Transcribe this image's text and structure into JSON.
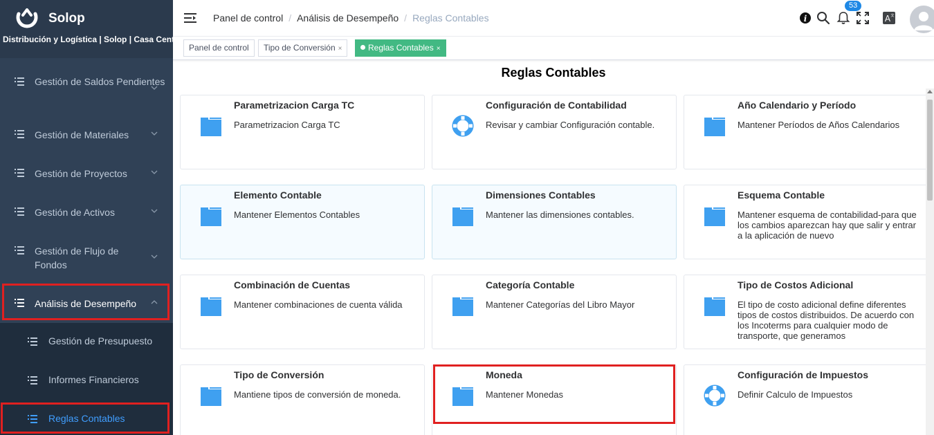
{
  "brand": {
    "name": "Solop",
    "subtitle": "Distribución y Logística | Solop | Casa Central"
  },
  "sidebar": {
    "items": [
      {
        "label": "Gestión de Saldos Pendientes",
        "expanded": false
      },
      {
        "label": "Gestión de Materiales",
        "expanded": false
      },
      {
        "label": "Gestión de Proyectos",
        "expanded": false
      },
      {
        "label": "Gestión de Activos",
        "expanded": false
      },
      {
        "label": "Gestión de Flujo de Fondos",
        "expanded": false
      },
      {
        "label": "Análisis de Desempeño",
        "expanded": true
      }
    ],
    "subitems": [
      {
        "label": "Gestión de Presupuesto"
      },
      {
        "label": "Informes Financieros"
      },
      {
        "label": "Reglas Contables",
        "selected": true
      }
    ]
  },
  "breadcrumb": [
    "Panel de control",
    "Análisis de Desempeño",
    "Reglas Contables"
  ],
  "navbar": {
    "notification_count": "53",
    "icons": [
      "info-icon",
      "search-icon",
      "bell-icon",
      "fullscreen-icon",
      "translate-icon",
      "avatar"
    ]
  },
  "tags": [
    {
      "label": "Panel de control",
      "closable": false
    },
    {
      "label": "Tipo de Conversión",
      "closable": true,
      "close": "×"
    },
    {
      "label": "Reglas Contables",
      "closable": true,
      "active": true,
      "close": "×"
    }
  ],
  "page_title": "Reglas Contables",
  "cards": [
    {
      "title": "Parametrizacion Carga TC",
      "desc": "Parametrizacion Carga TC",
      "icon": "folder-icon"
    },
    {
      "title": "Configuración de Contabilidad",
      "desc": "Revisar y cambiar Configuración contable.",
      "icon": "lifebuoy-icon"
    },
    {
      "title": "Año Calendario y Período",
      "desc": "Mantener Períodos de Años Calendarios",
      "icon": "folder-icon"
    },
    {
      "title": "Elemento Contable",
      "desc": "Mantener Elementos Contables",
      "icon": "folder-icon"
    },
    {
      "title": "Dimensiones Contables",
      "desc": "Mantener las dimensiones contables.",
      "icon": "folder-icon"
    },
    {
      "title": "Esquema Contable",
      "desc": "Mantener esquema de contabilidad-para que los cambios aparezcan hay que salir y entrar a la aplicación de nuevo",
      "icon": "folder-icon"
    },
    {
      "title": "Combinación de Cuentas",
      "desc": "Mantener combinaciones de cuenta válida",
      "icon": "folder-icon"
    },
    {
      "title": "Categoría Contable",
      "desc": "Mantener Categorías del Libro Mayor",
      "icon": "folder-icon"
    },
    {
      "title": "Tipo de Costos Adicional",
      "desc": "El tipo de costo adicional define diferentes tipos de costos distribuidos. De acuerdo con los Incoterms para cualquier modo de transporte, que generamos",
      "icon": "folder-icon"
    },
    {
      "title": "Tipo de Conversión",
      "desc": "Mantiene tipos de conversión de moneda.",
      "icon": "folder-icon"
    },
    {
      "title": "Moneda",
      "desc": "Mantener Monedas",
      "icon": "folder-icon"
    },
    {
      "title": "Configuración de Impuestos",
      "desc": "Definir Calculo de Impuestos",
      "icon": "lifebuoy-icon"
    }
  ],
  "colors": {
    "sidebar_bg": "#304156",
    "accent_blue": "#409eff",
    "tag_active": "#42b983",
    "highlight_red": "#e02020",
    "icon_blue": "#3fa0f0"
  }
}
